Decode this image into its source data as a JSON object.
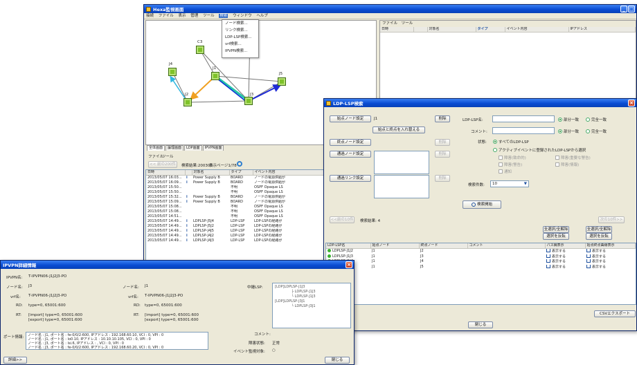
{
  "main": {
    "title": "Hexa監視画面",
    "menu": [
      "接続",
      "ファイル",
      "表示",
      "管理",
      "ツール",
      "検索",
      "ウィンドウ",
      "ヘルプ"
    ],
    "search_menu": [
      "ノード検索...",
      "リンク検索...",
      "LDP-LSP検索...",
      "vrf検索...",
      "IPVPN検索..."
    ],
    "nodes": [
      "C3",
      "J4",
      "J1",
      "J5",
      "J2",
      "J3"
    ],
    "tabs": [
      "全体画面",
      "論理画面",
      "LDP画面",
      "IPVPN画面"
    ],
    "log_menu": [
      "ファイル",
      "ツール"
    ],
    "log_prev": "<< 前の200件",
    "log_count": "検索結果:200300",
    "log_page": "表示ページ1/78",
    "log_headers": [
      "日時",
      "",
      "対象名",
      "タイプ",
      "イベント内容"
    ],
    "log_rows": [
      [
        "2013/05/07 16:03...",
        "i",
        "Power Supply B",
        "BOARD",
        "ノードの電源供給が"
      ],
      [
        "2013/05/07 16:09...",
        "i",
        "Power Supply B",
        "BOARD",
        "ノードの電源供給が"
      ],
      [
        "2013/05/07 15:50...",
        "",
        "",
        "不明",
        "OSPF Opaque LS"
      ],
      [
        "2013/05/07 15:50...",
        "",
        "",
        "不明",
        "OSPF Opaque LS"
      ],
      [
        "2013/05/07 15:32...",
        "i",
        "Power Supply B",
        "BOARD",
        "ノードの電源供給が"
      ],
      [
        "2013/05/07 15:09...",
        "i",
        "Power Supply B",
        "BOARD",
        "ノードの電源供給が"
      ],
      [
        "2013/05/07 15:08...",
        "",
        "",
        "不明",
        "OSPF Opaque LS"
      ],
      [
        "2013/05/07 15:08...",
        "",
        "",
        "不明",
        "OSPF Opaque LS"
      ],
      [
        "2013/05/07 14:51...",
        "",
        "",
        "不明",
        "OSPF Opaque LS"
      ],
      [
        "2013/05/07 14:49...",
        "i",
        "LDPLSP-J5J4",
        "LDP-LSP",
        "LDP-LSPの経路が"
      ],
      [
        "2013/05/07 14:49...",
        "i",
        "LDPLSP-J5J2",
        "LDP-LSP",
        "LDP-LSPの経路が"
      ],
      [
        "2013/05/07 14:49...",
        "i",
        "LDPLSP-J4J5",
        "LDP-LSP",
        "LDP-LSPの経路が"
      ],
      [
        "2013/05/07 14:49...",
        "i",
        "LDPLSP-J4J2",
        "LDP-LSP",
        "LDP-LSPの経路が"
      ],
      [
        "2013/05/07 14:49...",
        "i",
        "LDPLSP-J4J3",
        "LDP-LSP",
        "LDP-LSPの経路が"
      ]
    ],
    "right_menu": [
      "ファイル",
      "ツール"
    ],
    "right_headers": [
      "日時",
      "",
      "対象名",
      "タイプ",
      "イベント内容",
      "IPアドレス"
    ]
  },
  "ldp": {
    "title": "LDP-LSP検索",
    "start_btn": "始点ノード設定",
    "start_val": "J1",
    "delete": "削除",
    "swap_btn": "始点と終点を入れ替える",
    "end_btn": "終点ノード設定",
    "via_node_btn": "通過ノード設定",
    "via_link_btn": "通過リンク設定",
    "name_label": "LDP-LSP名:",
    "comment_label": "コメント:",
    "partial": "部分一致",
    "exact": "完全一致",
    "state_label": "状態:",
    "state_all": "すべてのLDP-LSP",
    "state_active": "アクティブイベントに登録されたLDP-LSPから選択",
    "checks": [
      "障害(致命的)",
      "障害(重要な警告)",
      "障害(警告)",
      "障害(情報)",
      "通知"
    ],
    "count_label": "検索件数:",
    "count_val": "10",
    "search_btn": "検索開始",
    "prev_btn": "<<前の10件",
    "result": "検索結果: 4",
    "next_btn": "次の10件>>",
    "select_all1": "全選択/全解除",
    "select_rev1": "選択を反転",
    "select_all2": "全選択/全解除",
    "select_rev2": "選択を反転",
    "headers": [
      "LDP-LSP名",
      "始点ノード",
      "終点ノード",
      "コメント",
      "パス構表示",
      "始点終点曲線表示"
    ],
    "rows": [
      [
        "LDPLSP-J1J2",
        "J1",
        "J2",
        "",
        "表示する",
        "表示する"
      ],
      [
        "LDPLSP-J1J3",
        "J1",
        "J3",
        "",
        "表示する",
        "表示する"
      ],
      [
        "LDPLSP-J1J4",
        "J1",
        "J4",
        "",
        "表示する",
        "表示する"
      ],
      [
        "LDPLSP-J1J5",
        "J1",
        "J5",
        "",
        "表示する",
        "表示する"
      ]
    ],
    "csv_btn": "CSVエクスポート",
    "close_btn": "閉じる"
  },
  "ipvpn": {
    "title": "IPVPN詳細情報",
    "name_label": "IPVPN名:",
    "name_val": "T-IPVPN06-J1J2J3-PO",
    "nodeA_label": "ノード名:",
    "nodeA_val": "J3",
    "nodeB_label": "ノード名:",
    "nodeB_val": "J1",
    "vrfA_label": "vrf名:",
    "vrfA_val": "T-IPVPN06-J1J2J3-PO",
    "vrfB_label": "vrf名:",
    "vrfB_val": "T-IPVPN06-J1J2J3-PO",
    "rdA_label": "RD:",
    "rdA_val": "type=0, 65001:600",
    "rdB_label": "RD:",
    "rdB_val": "type=0, 65001:600",
    "rtA_label": "RT:",
    "rtA_val1": "[import] type=0, 65001:600",
    "rtA_val2": "[export] type=0, 65001:600",
    "rtB_label": "RT:",
    "rtB_val1": "[import] type=0, 65001:600",
    "rtB_val2": "[export] type=0, 65001:600",
    "relay_label": "中継LSP:",
    "tree": [
      "[LDP]LDPLSP-J1J3",
      "├ LDPLSP-J1J3",
      "└ LDPLSP-J1J3",
      "[LDP]LDPLSP-J3J1",
      "└ LDPLSP-J3J1"
    ],
    "port_label": "ポート情報:",
    "ports": [
      "ノード名 : J1, ポート名 : fe-0/0/2:600, IPアドレス : 192.168.60.10, VCI : 0, VPI : 0",
      "ノード名 : J1, ポート名 : lo0.10, IPアドレス : 10.10.10.105, VCI : 0, VPI : 0",
      "ノード名 : J3, ポート名 : lsi.6, IPアドレス : , VCI : 0, VPI : 0",
      "ノード名 : J3, ポート名 : fe-0/0/2:600, IPアドレス : 192.168.60.20, VCI : 0, VPI : 0"
    ],
    "comment_label": "コメント:",
    "fault_label": "障害状態:",
    "fault_val": "正常",
    "event_label": "イベント監視対象:",
    "event_val": "○",
    "detail_btn": "詳細>>",
    "close_btn": "閉じる"
  },
  "colors": {
    "title_bar": "#0a4cd3",
    "node": "#7ec22a",
    "arrow_cyan": "#2fb7e0",
    "arrow_blue": "#1f2bd6",
    "arrow_orange": "#f0a020"
  }
}
